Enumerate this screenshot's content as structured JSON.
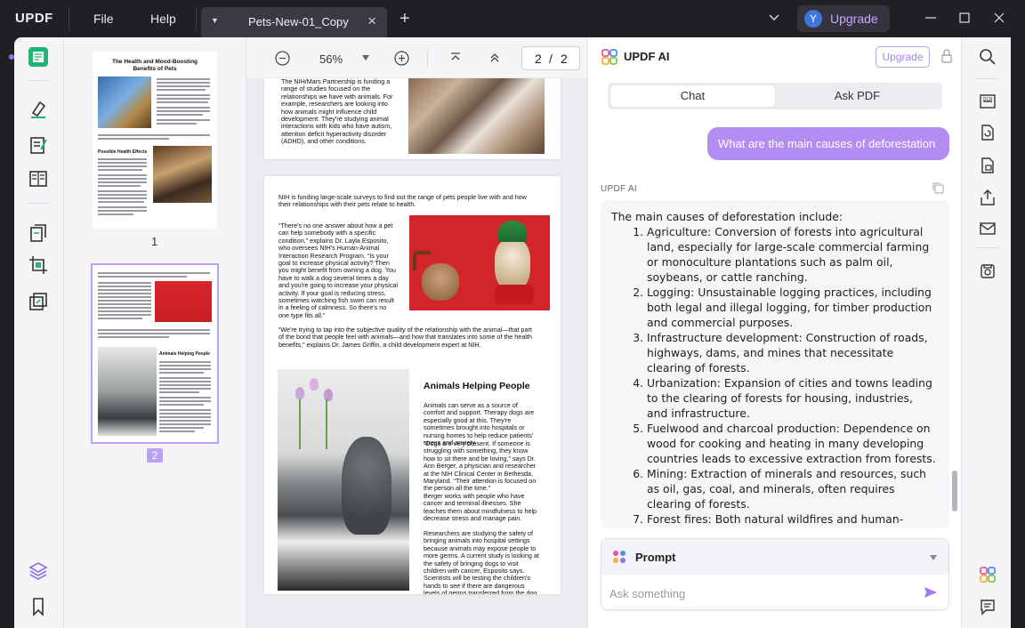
{
  "app": {
    "logo_text": "UPDF",
    "menu": [
      "File",
      "Help"
    ]
  },
  "tab": {
    "title": "Pets-New-01_Copy"
  },
  "account": {
    "avatar_initial": "Y",
    "upgrade_label": "Upgrade"
  },
  "toolbar": {
    "zoom": "56%",
    "page_current": "2",
    "page_sep": "/",
    "page_total": "2"
  },
  "thumbnails": [
    {
      "number": "1"
    },
    {
      "number": "2"
    }
  ],
  "document": {
    "page1_bottom_text": "The NIH/Mars Partnership is funding a range of studies focused on the relationships we have with animals. For example, researchers are looking into how animals might influence child development. They're studying animal interactions with kids who have autism, attention deficit hyperactivity disorder (ADHD), and other conditions.",
    "page2_intro": "NIH is funding large-scale surveys to find out the range of pets people live with and how their relationships with their pets relate to health.",
    "page2_quote1": "“There's no one answer about how a pet can help somebody with a specific condition,” explains Dr. Layla Esposito, who oversees NIH's Human-Animal Interaction Research Program. “Is your goal to increase physical activity? Then you might benefit from owning a dog. You have to walk a dog several times a day and you're going to increase your physical activity.  If your goal is reducing stress, sometimes watching fish swim can result in a feeling of calmness. So there's no one type fits all.”",
    "page2_quote2": "“We're trying to tap into the subjective quality of the relationship with the animal—that part of the bond that people feel with animals—and how that translates into some of the health benefits,” explains Dr. James Griffin, a child development expert at NIH.",
    "page2_heading": "Animals Helping People",
    "page2_col1": "Animals can serve as a source of comfort and support. Therapy dogs are especially good at this. They're sometimes brought into hospitals or nursing homes to help reduce patients' stress and anxiety.",
    "page2_col2": "“Dogs are very present. If someone is struggling with something, they know how to sit there and be loving,” says Dr. Ann Berger, a physician and researcher at the NIH Clinical Center in Bethesda, Maryland. “Their attention is focused on the person all the time.”",
    "page2_col3": "Berger works with people who have cancer and terminal illnesses. She teaches them about mindfulness to help decrease stress and manage pain.",
    "page2_col4": "Researchers are studying the safety of bringing animals into hospital settings because animals may expose people to more germs. A current study is looking at the safety of bringing dogs to visit children with cancer, Esposito says. Scientists will be testing the children's hands to see if there are dangerous levels of germs transferred from the dog after the visit."
  },
  "ai_panel": {
    "title": "UPDF AI",
    "upgrade_label": "Upgrade",
    "tabs": [
      "Chat",
      "Ask PDF"
    ],
    "user_message": "What are the main causes of deforestation",
    "ai_label": "UPDF AI",
    "answer_intro": "The main causes of deforestation include:",
    "answer_items": [
      "Agriculture: Conversion of forests into agricultural land, especially for large-scale commercial farming or monoculture plantations such as palm oil, soybeans, or cattle ranching.",
      "Logging: Unsustainable logging practices, including both legal and illegal logging, for timber production and commercial purposes.",
      "Infrastructure development: Construction of roads, highways, dams, and mines that necessitate clearing of forests.",
      "Urbanization: Expansion of cities and towns leading to the clearing of forests for housing, industries, and infrastructure.",
      "Fuelwood and charcoal production: Dependence on wood for cooking and heating in many developing countries leads to excessive extraction from forests.",
      "Mining: Extraction of minerals and resources, such as oil, gas, coal, and minerals, often requires clearing of forests.",
      "Forest fires: Both natural wildfires and human-induced"
    ],
    "prompt_label": "Prompt",
    "input_placeholder": "Ask something"
  },
  "colors": {
    "accent": "#b38df2",
    "titlebar": "#1f1f24",
    "tab_active": "#3a3a44"
  }
}
